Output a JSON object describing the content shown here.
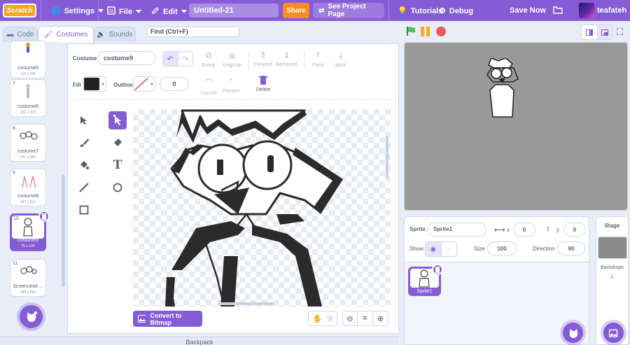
{
  "menubar": {
    "logo_text": "Scratch",
    "settings": "Settings",
    "file": "File",
    "edit": "Edit",
    "project_title": "Untitled-21",
    "share": "Share",
    "see_project_page": "See Project Page",
    "tutorials": "Tutorials",
    "debug": "Debug",
    "save_now": "Save Now",
    "username": "teafateh"
  },
  "tabs": {
    "code": "Code",
    "costumes": "Costumes",
    "sounds": "Sounds"
  },
  "find_placeholder": "Find (Ctrl+F)",
  "costumes": [
    {
      "num": "",
      "name": "costume5",
      "size": "118 x 345"
    },
    {
      "num": "7",
      "name": "costume6",
      "size": "152 x 376"
    },
    {
      "num": "8",
      "name": "costume7",
      "size": "617 x 335"
    },
    {
      "num": "9",
      "name": "costume8",
      "size": "347 x 312"
    },
    {
      "num": "10",
      "name": "costume9",
      "size": "75 x 130"
    },
    {
      "num": "11",
      "name": "Screenshot ...",
      "size": "383 x 291"
    }
  ],
  "editor": {
    "costume_label": "Costume",
    "costume_name": "costume9",
    "fill_label": "Fill",
    "outline_label": "Outline",
    "outline_width": "0",
    "group": "Group",
    "ungroup": "Ungroup",
    "forward": "Forward",
    "backward": "Backward",
    "front": "Front",
    "back": "Back",
    "curved": "Curved",
    "pointed": "Pointed",
    "delete": "Delete",
    "convert": "Convert to Bitmap",
    "zoom_reset": "="
  },
  "backpack": "Backpack",
  "sprite": {
    "label": "Sprite",
    "name": "Sprite1",
    "x_label": "x",
    "x": "0",
    "y_label": "y",
    "y": "0",
    "show_label": "Show",
    "size_label": "Size",
    "size": "100",
    "direction_label": "Direction",
    "direction": "90",
    "thumb_name": "Sprite1"
  },
  "stage_panel": {
    "title": "Stage",
    "backdrops_label": "Backdrops",
    "backdrops_count": "1"
  },
  "colors": {
    "accent": "#855cd6",
    "share": "#ff8c1a",
    "fill": "#222222"
  }
}
